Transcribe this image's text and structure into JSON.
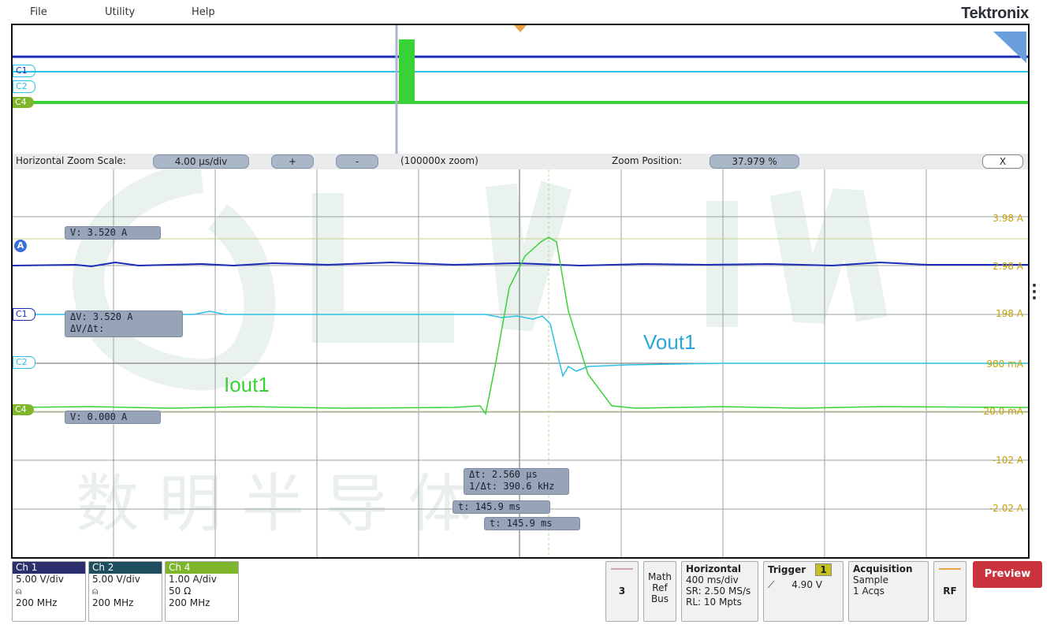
{
  "menu": {
    "file": "File",
    "utility": "Utility",
    "help": "Help",
    "brand": "Tektronix"
  },
  "overview": {
    "channels": [
      "C1",
      "C2",
      "C4"
    ]
  },
  "zoom_bar": {
    "scale_label": "Horizontal Zoom Scale:",
    "scale_value": "4.00 µs/div",
    "plus": "+",
    "minus": "-",
    "zoom_factor": "(100000x zoom)",
    "position_label": "Zoom Position:",
    "position_value": "37.979 %",
    "close": "X"
  },
  "plot": {
    "channel_tags": [
      "C1",
      "C2",
      "C4"
    ],
    "ref_badge": "A",
    "cursor_a_value": "V:  3.520 A",
    "cursor_b_value": "V:  0.000 A",
    "delta_v": "ΔV:    3.520 A",
    "delta_v_dt": "ΔV/Δt:",
    "delta_t": "Δt:   2.560 µs",
    "inv_delta_t": "1/Δt:  390.6 kHz",
    "t1": "t:  145.9 ms",
    "t2": "t:   145.9 ms",
    "scale_labels": [
      "3.98 A",
      "2.98 A",
      "198 A",
      "980 mA",
      "-20.0 mA",
      "-102 A",
      "-2.02 A"
    ],
    "label_vout": "Vout1",
    "label_iout": "Iout1",
    "watermark": "数 明 半 导 体"
  },
  "channels": [
    {
      "name": "Ch 1",
      "color": "#2b2f6e",
      "lines": [
        "5.00 V/div",
        "⍝",
        "200 MHz"
      ]
    },
    {
      "name": "Ch 2",
      "color": "#1f4f5f",
      "lines": [
        "5.00 V/div",
        "⍝",
        "200 MHz"
      ]
    },
    {
      "name": "Ch 4",
      "color": "#7fb52a",
      "lines": [
        "1.00 A/div",
        "50 Ω",
        "200 MHz"
      ]
    }
  ],
  "status": {
    "ref_count": "3",
    "math": [
      "Math",
      "Ref",
      "Bus"
    ],
    "horizontal": {
      "title": "Horizontal",
      "lines": [
        "400 ms/div",
        "SR: 2.50 MS/s",
        "RL: 10 Mpts"
      ]
    },
    "trigger": {
      "title": "Trigger",
      "channel": "1",
      "slope": "⟋",
      "level": "4.90 V"
    },
    "acquisition": {
      "title": "Acquisition",
      "lines": [
        "Sample",
        "1 Acqs"
      ]
    },
    "rf": "RF",
    "preview": "Preview"
  },
  "colors": {
    "ch1": "#1a2bb8",
    "ch2": "#29c1e6",
    "ch4": "#39d338",
    "cursor": "#c5d08a",
    "preview": "#c9333b"
  }
}
